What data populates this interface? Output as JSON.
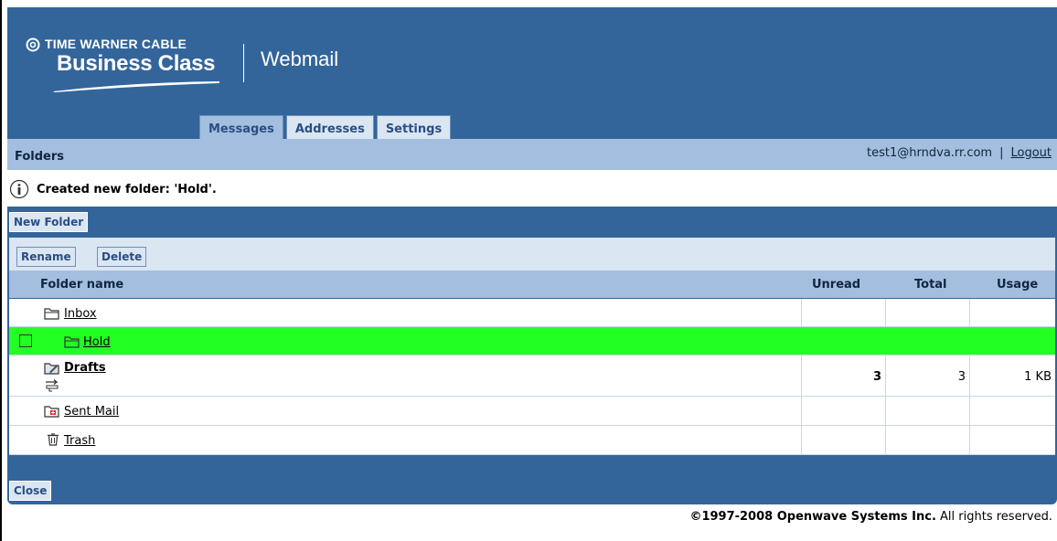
{
  "brand": {
    "top": "TIME WARNER CABLE",
    "main": "Business Class",
    "product": "Webmail"
  },
  "tabs": [
    {
      "label": "Messages"
    },
    {
      "label": "Addresses"
    },
    {
      "label": "Settings"
    }
  ],
  "folders_bar": {
    "title": "Folders",
    "user": "test1@hrndva.rr.com",
    "separator": "|",
    "logout": "Logout"
  },
  "notice": {
    "text": "Created new folder: 'Hold'."
  },
  "toolbar": {
    "new_folder": "New Folder",
    "rename": "Rename",
    "delete": "Delete",
    "close": "Close"
  },
  "table": {
    "columns": {
      "name": "Folder name",
      "unread": "Unread",
      "total": "Total",
      "usage": "Usage"
    },
    "rows": [
      {
        "name": "Inbox",
        "icon": "folder-icon",
        "unread": "",
        "total": "",
        "usage": ""
      },
      {
        "name": "Hold",
        "icon": "folder-icon",
        "unread": "",
        "total": "",
        "usage": "",
        "selected": true
      },
      {
        "name": "Drafts",
        "icon": "drafts-icon",
        "unread": "3",
        "total": "3",
        "usage": "1 KB"
      },
      {
        "name": "Sent Mail",
        "icon": "sent-mail-icon",
        "unread": "",
        "total": "",
        "usage": ""
      },
      {
        "name": "Trash",
        "icon": "trash-icon",
        "unread": "",
        "total": "",
        "usage": ""
      }
    ]
  },
  "footer": {
    "copyright": "©1997-2008 Openwave Systems Inc.",
    "rights": " All rights reserved."
  },
  "colors": {
    "header": "#33659a",
    "light_bar": "#a4bedf",
    "selected_row": "#22ff22"
  }
}
